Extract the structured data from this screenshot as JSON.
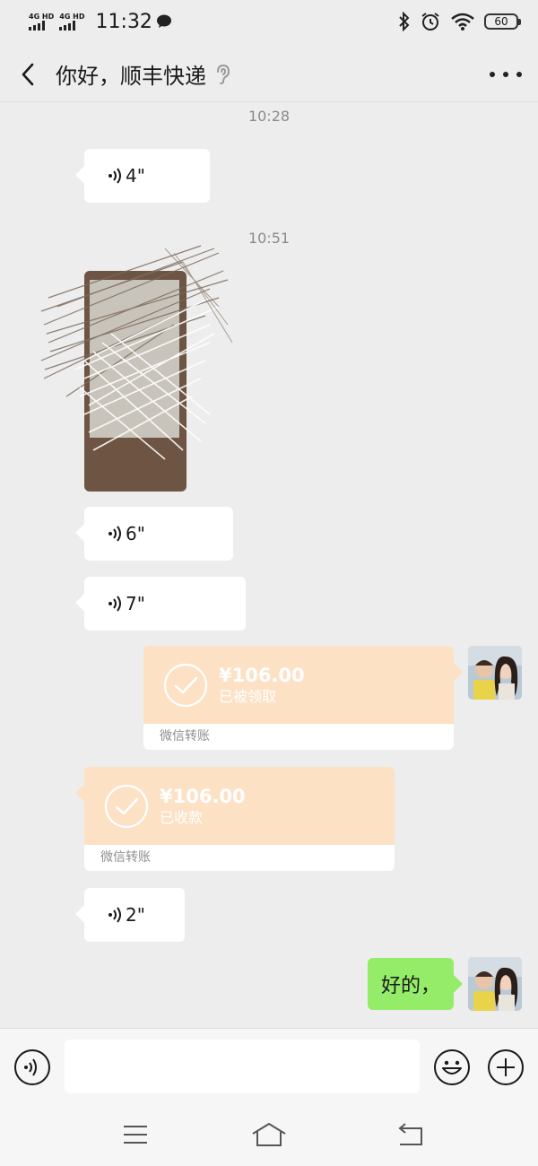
{
  "status_bar": {
    "network_1": "4G HD",
    "network_2": "4G HD",
    "time": "11:32",
    "battery": "60"
  },
  "header": {
    "title": "你好，顺丰快递"
  },
  "messages": {
    "time_1": "10:28",
    "voice_1": "4\"",
    "time_2": "10:51",
    "voice_2": "6\"",
    "voice_3": "7\"",
    "transfer_out": {
      "amount": "¥106.00",
      "status": "已被领取",
      "footer": "微信转账"
    },
    "transfer_in": {
      "amount": "¥106.00",
      "status": "已收款",
      "footer": "微信转账"
    },
    "voice_4": "2\"",
    "text_out": "好的，"
  },
  "input": {
    "value": "",
    "placeholder": ""
  },
  "icons": {
    "back": "chevron-left-icon",
    "ear": "ear-icon",
    "more": "more-icon",
    "voice": "voice-icon",
    "check": "check-icon",
    "emoji": "emoji-icon",
    "plus": "plus-icon"
  },
  "colors": {
    "background": "#ededed",
    "transfer_bubble": "#fce1c5",
    "outgoing_bubble": "#95ec69"
  }
}
